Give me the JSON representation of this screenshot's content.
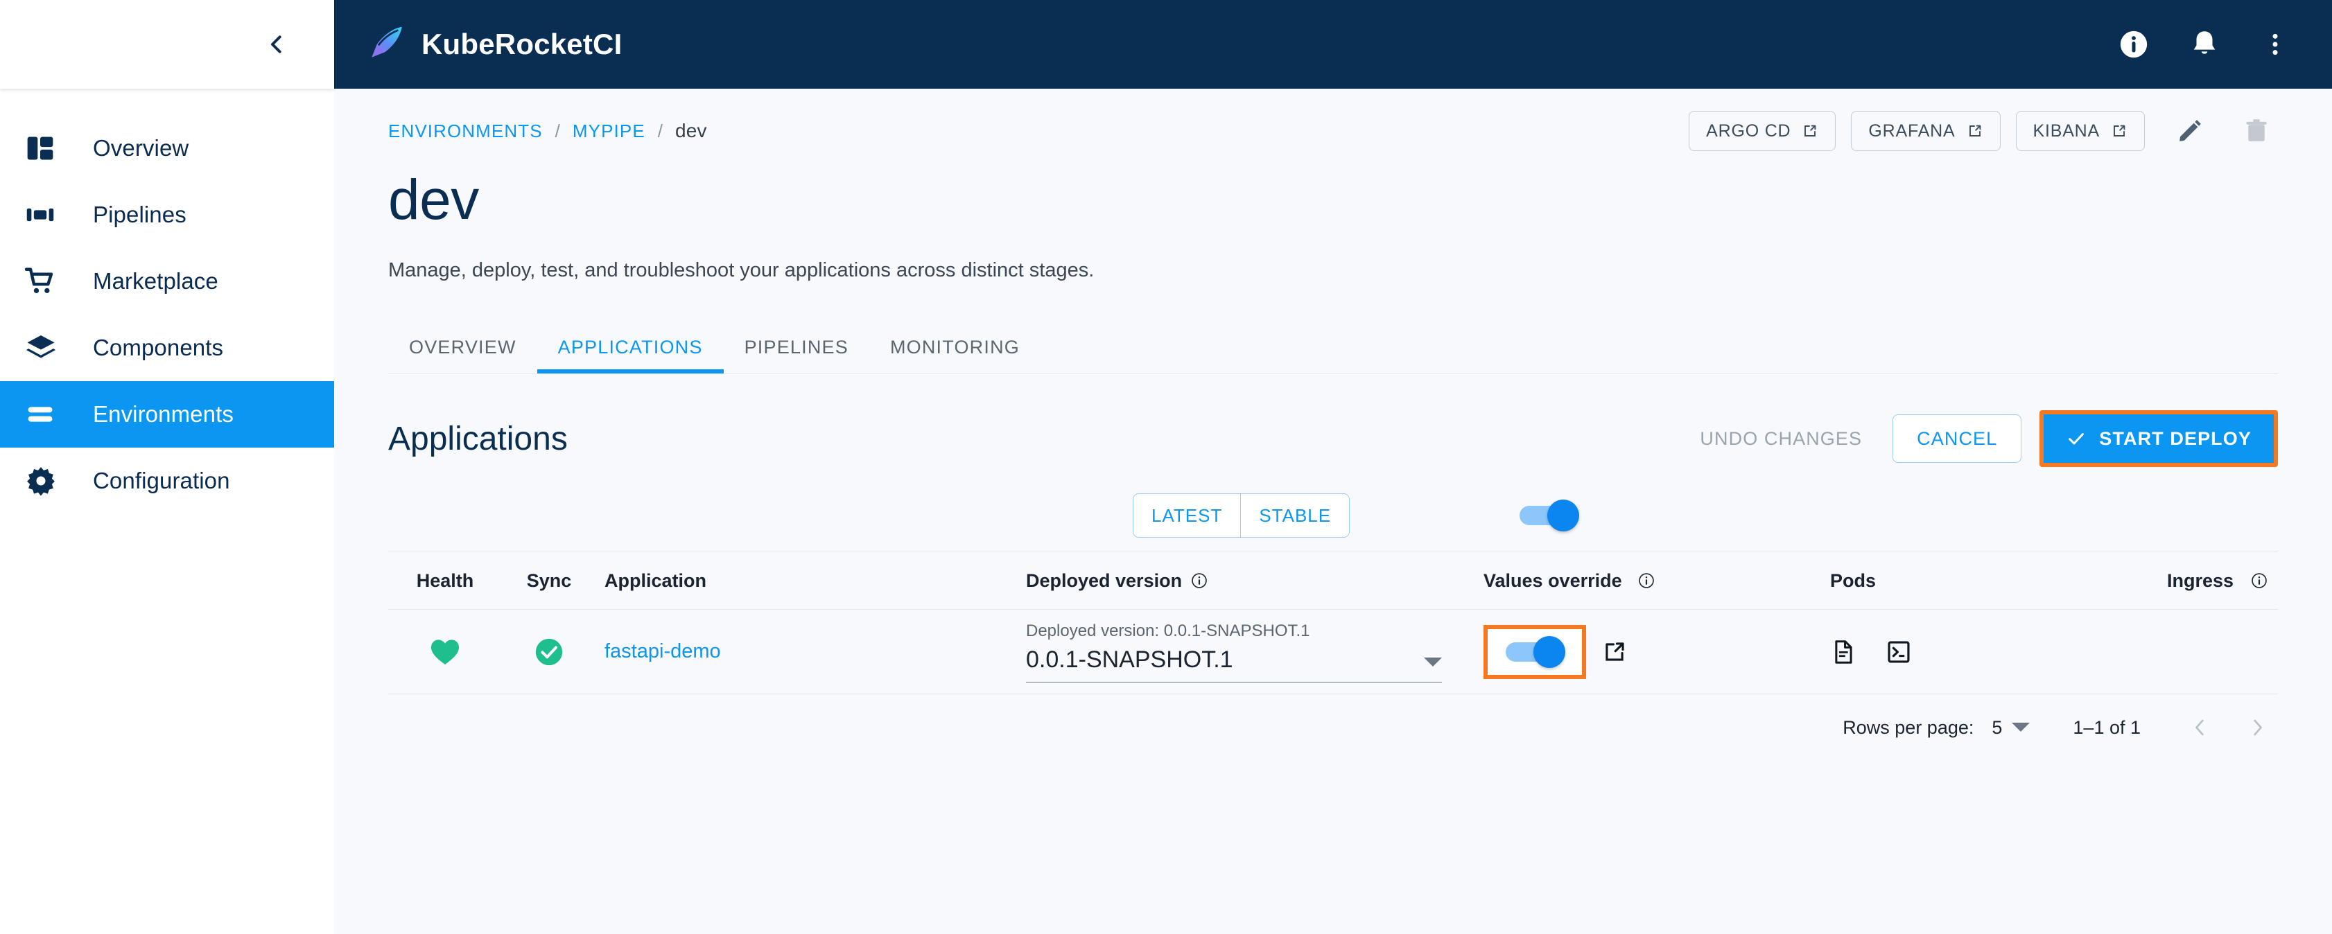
{
  "app": {
    "brand_title": "KubeRocketCI",
    "logo_icon": "rocket-icon"
  },
  "topbar": {
    "info_icon": "info-circle-icon",
    "notifications_icon": "bell-icon",
    "more_icon": "kebab-menu-icon"
  },
  "sidebar": {
    "collapse_icon": "chevron-left-icon",
    "items": [
      {
        "label": "Overview",
        "icon": "dashboard-icon",
        "active": false
      },
      {
        "label": "Pipelines",
        "icon": "pipelines-icon",
        "active": false
      },
      {
        "label": "Marketplace",
        "icon": "cart-icon",
        "active": false
      },
      {
        "label": "Components",
        "icon": "layers-icon",
        "active": false
      },
      {
        "label": "Environments",
        "icon": "environments-icon",
        "active": true
      },
      {
        "label": "Configuration",
        "icon": "gear-icon",
        "active": false
      }
    ]
  },
  "breadcrumb": {
    "items": [
      {
        "label": "ENVIRONMENTS",
        "current": false
      },
      {
        "label": "MYPIPE",
        "current": false
      },
      {
        "label": "dev",
        "current": true
      }
    ],
    "separator": "/"
  },
  "header_actions": {
    "links": [
      {
        "label": "ARGO CD",
        "icon": "external-link-icon"
      },
      {
        "label": "GRAFANA",
        "icon": "external-link-icon"
      },
      {
        "label": "KIBANA",
        "icon": "external-link-icon"
      }
    ],
    "edit_icon": "pencil-icon",
    "delete_icon": "trash-icon"
  },
  "page": {
    "title": "dev",
    "description": "Manage, deploy, test, and troubleshoot your applications across distinct stages."
  },
  "tabs": [
    {
      "label": "OVERVIEW",
      "active": false
    },
    {
      "label": "APPLICATIONS",
      "active": true
    },
    {
      "label": "PIPELINES",
      "active": false
    },
    {
      "label": "MONITORING",
      "active": false
    }
  ],
  "applications": {
    "title": "Applications",
    "undo_label": "UNDO CHANGES",
    "cancel_label": "CANCEL",
    "deploy_label": "START DEPLOY",
    "deploy_icon": "check-icon",
    "deploy_highlight_color": "#F47920",
    "accent_color": "#0B96F1",
    "filter": {
      "segments": [
        {
          "label": "LATEST"
        },
        {
          "label": "STABLE"
        }
      ],
      "toggle_state": "on"
    },
    "columns": [
      {
        "label": "Health",
        "info": false
      },
      {
        "label": "Sync",
        "info": false
      },
      {
        "label": "Application",
        "info": false
      },
      {
        "label": "Deployed version",
        "info": true
      },
      {
        "label": "Values override",
        "info": true
      },
      {
        "label": "Pods",
        "info": false
      },
      {
        "label": "Ingress",
        "info": true
      }
    ],
    "rows": [
      {
        "health_icon": "heart-icon",
        "health_color": "#1FBE8E",
        "sync_icon": "check-circle-icon",
        "sync_color": "#1FBE8E",
        "name": "fastapi-demo",
        "deployed_version_label": "Deployed version: 0.0.1-SNAPSHOT.1",
        "version_value": "0.0.1-SNAPSHOT.1",
        "values_override_state": "on",
        "values_override_highlighted": true,
        "values_override_link_icon": "external-link-icon",
        "pods_icons": [
          "document-icon",
          "terminal-icon"
        ],
        "ingress": ""
      }
    ],
    "footer": {
      "rows_per_page_label": "Rows per page:",
      "rows_per_page_value": "5",
      "range_label": "1–1 of 1",
      "prev_icon": "chevron-left-icon",
      "next_icon": "chevron-right-icon"
    }
  }
}
